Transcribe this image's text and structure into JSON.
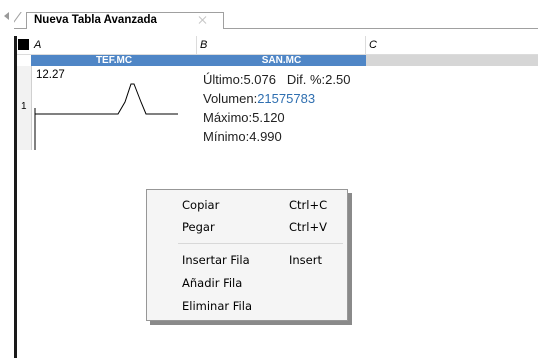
{
  "tab": {
    "title": "Nueva Tabla Avanzada"
  },
  "columns": [
    "A",
    "B",
    "C"
  ],
  "rows": [
    {
      "number": "1",
      "cell_a": {
        "symbol": "TEF.MC",
        "sparkline_label": "12.27"
      },
      "cell_b": {
        "symbol": "SAN.MC",
        "ultimo_label": "Último:",
        "ultimo_value": "5.076",
        "dif_label": "Dif. %:",
        "dif_value": "2.50",
        "volumen_label": "Volumen:",
        "volumen_value": "21575783",
        "maximo_label": "Máximo:",
        "maximo_value": "5.120",
        "minimo_label": "Mínimo:",
        "minimo_value": "4.990"
      }
    }
  ],
  "context_menu": {
    "items": [
      {
        "label": "Copiar",
        "shortcut": "Ctrl+C"
      },
      {
        "label": "Pegar",
        "shortcut": "Ctrl+V"
      },
      {
        "label": "Insertar Fila",
        "shortcut": "Insert"
      },
      {
        "label": "Añadir Fila",
        "shortcut": ""
      },
      {
        "label": "Eliminar Fila",
        "shortcut": ""
      }
    ]
  },
  "colors": {
    "symbol_bar": "#4f86c6",
    "link_text": "#2f6fb0"
  }
}
